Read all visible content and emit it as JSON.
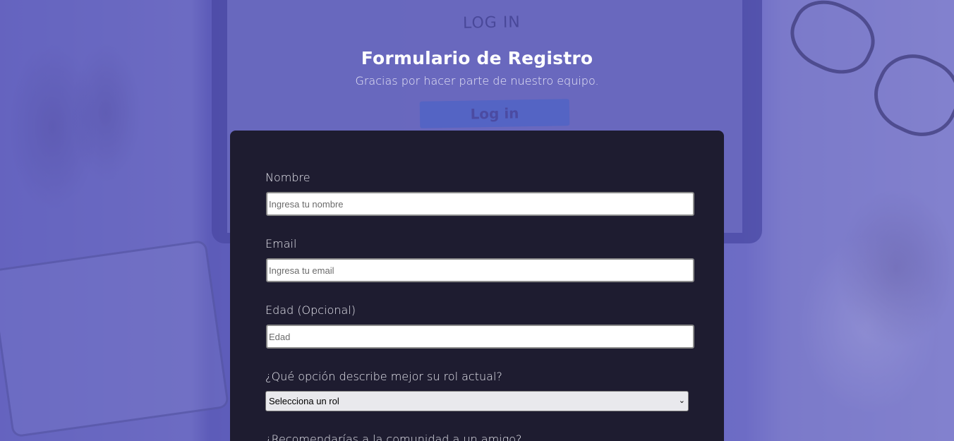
{
  "background": {
    "screen_heading": "LOG IN",
    "screen_button": "Log in"
  },
  "header": {
    "title": "Formulario de Registro",
    "subtitle": "Gracias por hacer parte de nuestro equipo."
  },
  "form": {
    "name": {
      "label": "Nombre",
      "placeholder": "Ingresa tu nombre"
    },
    "email": {
      "label": "Email",
      "placeholder": "Ingresa tu email"
    },
    "age": {
      "label": "Edad (Opcional)",
      "placeholder": "Edad"
    },
    "role": {
      "label": "¿Qué opción describe mejor su rol actual?",
      "selected": "Selecciona un rol"
    },
    "next_question": "¿Recomendarías a la comunidad a un amigo?"
  },
  "colors": {
    "card_bg": "#1e1c30",
    "overlay": "#5c5abe",
    "text_light": "#e8e8f0"
  },
  "icons": {
    "select_arrow": "chevron-down-icon"
  }
}
